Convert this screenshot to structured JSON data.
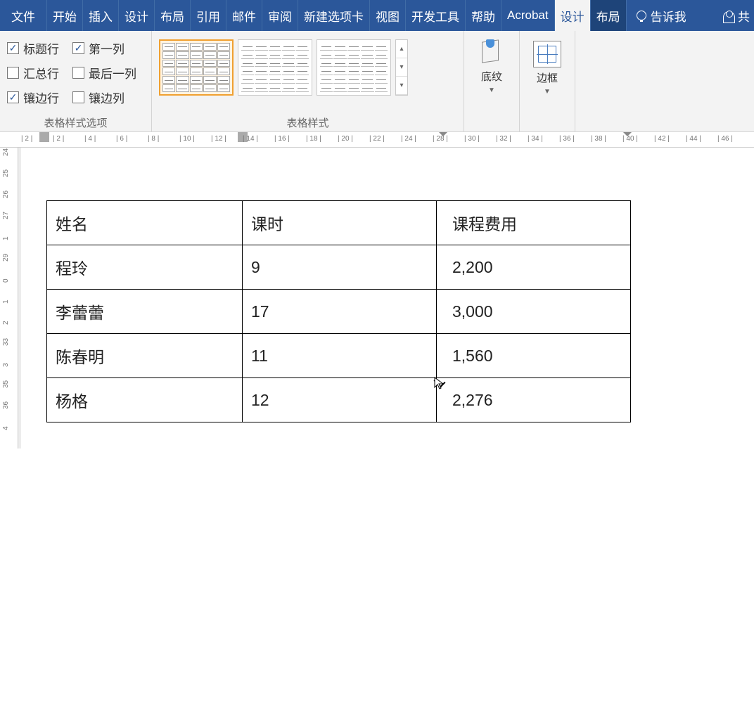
{
  "tabs": {
    "file": "文件",
    "home": "开始",
    "insert": "插入",
    "design_doc": "设计",
    "layout_doc": "布局",
    "ref": "引用",
    "mail": "邮件",
    "review": "审阅",
    "newtab": "新建选项卡",
    "view": "视图",
    "dev": "开发工具",
    "help": "帮助",
    "acrobat": "Acrobat",
    "design": "设计",
    "layout": "布局",
    "tellme": "告诉我",
    "share": "共"
  },
  "style_options": {
    "header_row": "标题行",
    "first_col": "第一列",
    "total_row": "汇总行",
    "last_col": "最后一列",
    "banded_row": "镶边行",
    "banded_col": "镶边列",
    "checked": {
      "header_row": true,
      "first_col": true,
      "total_row": false,
      "last_col": false,
      "banded_row": true,
      "banded_col": false
    }
  },
  "group_labels": {
    "options": "表格样式选项",
    "styles": "表格样式"
  },
  "buttons": {
    "shading": "底纹",
    "borders": "边框"
  },
  "ruler_h": [
    "2",
    "2",
    "4",
    "6",
    "8",
    "10",
    "12",
    "14",
    "16",
    "18",
    "20",
    "22",
    "24",
    "28",
    "30",
    "32",
    "34",
    "36",
    "38",
    "40",
    "42",
    "44",
    "46"
  ],
  "ruler_v": [
    "24",
    "25",
    "26",
    "27",
    "1",
    "29",
    "0",
    "1",
    "2",
    "33",
    "3",
    "35",
    "36",
    "4"
  ],
  "table": {
    "headers": [
      "姓名",
      "课时",
      "课程费用"
    ],
    "rows": [
      [
        "程玲",
        "9",
        "2,200"
      ],
      [
        "李蕾蕾",
        "17",
        "3,000"
      ],
      [
        "陈春明",
        "11",
        "1,560"
      ],
      [
        "杨格",
        "12",
        "2,276"
      ]
    ]
  }
}
